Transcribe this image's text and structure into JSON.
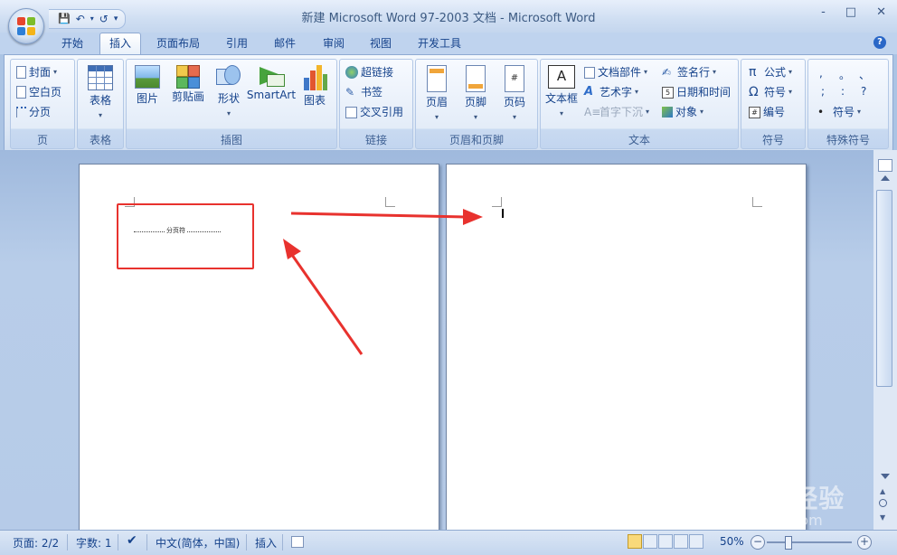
{
  "window": {
    "title": "新建 Microsoft Word 97-2003 文档 - Microsoft Word",
    "controls": [
      "-",
      "□",
      "✕"
    ]
  },
  "qat": {
    "save": "💾",
    "undo": "↶",
    "redo": "↺",
    "more": "▾"
  },
  "tabs": [
    "开始",
    "插入",
    "页面布局",
    "引用",
    "邮件",
    "审阅",
    "视图",
    "开发工具"
  ],
  "active_tab": "插入",
  "ribbon": {
    "pages": {
      "label": "页",
      "items": [
        "封面",
        "空白页",
        "分页"
      ]
    },
    "table": {
      "label": "表格",
      "button": "表格"
    },
    "illustrations": {
      "label": "插图",
      "buttons": [
        "图片",
        "剪贴画",
        "形状",
        "SmartArt",
        "图表"
      ]
    },
    "links": {
      "label": "链接",
      "items": [
        "超链接",
        "书签",
        "交叉引用"
      ]
    },
    "header_footer": {
      "label": "页眉和页脚",
      "buttons": [
        "页眉",
        "页脚",
        "页码"
      ]
    },
    "text": {
      "label": "文本",
      "textbox": "文本框",
      "items": [
        "文档部件",
        "艺术字",
        "首字下沉",
        "签名行",
        "日期和时间",
        "对象"
      ]
    },
    "symbols": {
      "label": "符号",
      "items": [
        "公式",
        "符号",
        "编号"
      ]
    },
    "special": {
      "label": "特殊符号",
      "chars": [
        ",",
        "。",
        "、",
        ";",
        ":",
        "?"
      ],
      "more": "符号"
    }
  },
  "document": {
    "page_break_text": "分页符"
  },
  "statusbar": {
    "page": "页面: 2/2",
    "words": "字数: 1",
    "language": "中文(简体，中国)",
    "mode": "插入",
    "zoom": "50%"
  },
  "watermark": {
    "brand": "Bai du 经验",
    "url": "jingyan.baidu.com"
  },
  "colors": {
    "accent": "#15428b",
    "annotation": "#e8322e"
  }
}
